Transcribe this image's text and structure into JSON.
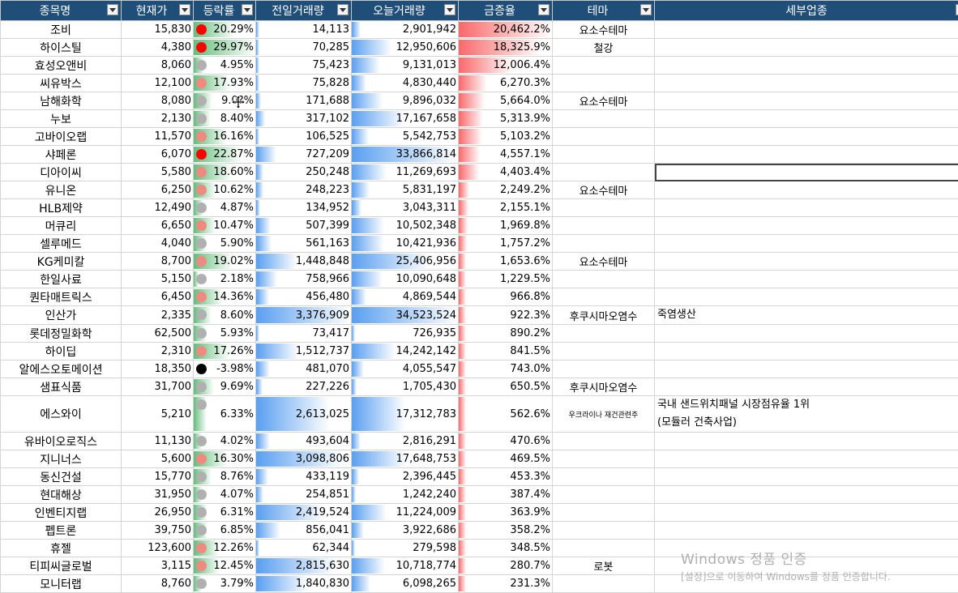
{
  "headers": [
    {
      "label": "종목명"
    },
    {
      "label": "현재가"
    },
    {
      "label": "등락률"
    },
    {
      "label": "전일거래량"
    },
    {
      "label": "오늘거래량"
    },
    {
      "label": "금증율"
    },
    {
      "label": "테마"
    },
    {
      "label": "세부업종"
    }
  ],
  "colors": {
    "header_bg": "#1f4e79",
    "bar_green": "#63be7b",
    "bar_blue": "#5a9ff0",
    "bar_red": "#f8696b",
    "dot_red": "#ff0000",
    "dot_pink": "#f08a80",
    "dot_gray": "#b0b0b0",
    "dot_black": "#000000"
  },
  "rows": [
    {
      "name": "조비",
      "price": "15,830",
      "change": "20.29%",
      "dot": "red",
      "chg_pct": 20.29,
      "prev_vol": "14,113",
      "prev_vol_n": 14113,
      "today_vol": "2,901,942",
      "today_vol_n": 2901942,
      "ratio": "20,462.2%",
      "ratio_n": 20462.2,
      "theme": "요소수테마",
      "theme_small": false,
      "sector": ""
    },
    {
      "name": "하이스틸",
      "price": "4,380",
      "change": "29.97%",
      "dot": "red",
      "chg_pct": 29.97,
      "prev_vol": "70,285",
      "prev_vol_n": 70285,
      "today_vol": "12,950,606",
      "today_vol_n": 12950606,
      "ratio": "18,325.9%",
      "ratio_n": 18325.9,
      "theme": "철강",
      "theme_small": false,
      "sector": ""
    },
    {
      "name": "효성오앤비",
      "price": "8,060",
      "change": "4.95%",
      "dot": "gray",
      "chg_pct": 4.95,
      "prev_vol": "75,423",
      "prev_vol_n": 75423,
      "today_vol": "9,131,013",
      "today_vol_n": 9131013,
      "ratio": "12,006.4%",
      "ratio_n": 12006.4,
      "theme": "",
      "theme_small": false,
      "sector": ""
    },
    {
      "name": "씨유박스",
      "price": "12,100",
      "change": "17.93%",
      "dot": "pink",
      "chg_pct": 17.93,
      "prev_vol": "75,828",
      "prev_vol_n": 75828,
      "today_vol": "4,830,440",
      "today_vol_n": 4830440,
      "ratio": "6,270.3%",
      "ratio_n": 6270.3,
      "theme": "",
      "theme_small": false,
      "sector": ""
    },
    {
      "name": "남해화학",
      "price": "8,080",
      "change": "9.0?%",
      "dot": "gray",
      "chg_pct": 9.0,
      "prev_vol": "171,688",
      "prev_vol_n": 171688,
      "today_vol": "9,896,032",
      "today_vol_n": 9896032,
      "ratio": "5,664.0%",
      "ratio_n": 5664.0,
      "theme": "요소수테마",
      "theme_small": false,
      "sector": ""
    },
    {
      "name": "누보",
      "price": "2,130",
      "change": "8.40%",
      "dot": "gray",
      "chg_pct": 8.4,
      "prev_vol": "317,102",
      "prev_vol_n": 317102,
      "today_vol": "17,167,658",
      "today_vol_n": 17167658,
      "ratio": "5,313.9%",
      "ratio_n": 5313.9,
      "theme": "",
      "theme_small": false,
      "sector": ""
    },
    {
      "name": "고바이오랩",
      "price": "11,570",
      "change": "16.16%",
      "dot": "pink",
      "chg_pct": 16.16,
      "prev_vol": "106,525",
      "prev_vol_n": 106525,
      "today_vol": "5,542,753",
      "today_vol_n": 5542753,
      "ratio": "5,103.2%",
      "ratio_n": 5103.2,
      "theme": "",
      "theme_small": false,
      "sector": ""
    },
    {
      "name": "샤페론",
      "price": "6,070",
      "change": "22.87%",
      "dot": "red",
      "chg_pct": 22.87,
      "prev_vol": "727,209",
      "prev_vol_n": 727209,
      "today_vol": "33,866,814",
      "today_vol_n": 33866814,
      "ratio": "4,557.1%",
      "ratio_n": 4557.1,
      "theme": "",
      "theme_small": false,
      "sector": ""
    },
    {
      "name": "디아이씨",
      "price": "5,580",
      "change": "18.60%",
      "dot": "pink",
      "chg_pct": 18.6,
      "prev_vol": "250,248",
      "prev_vol_n": 250248,
      "today_vol": "11,269,693",
      "today_vol_n": 11269693,
      "ratio": "4,403.4%",
      "ratio_n": 4403.4,
      "theme": "",
      "theme_small": false,
      "sector": ""
    },
    {
      "name": "유니온",
      "price": "6,250",
      "change": "10.62%",
      "dot": "pink",
      "chg_pct": 10.62,
      "prev_vol": "248,223",
      "prev_vol_n": 248223,
      "today_vol": "5,831,197",
      "today_vol_n": 5831197,
      "ratio": "2,249.2%",
      "ratio_n": 2249.2,
      "theme": "요소수테마",
      "theme_small": false,
      "sector": ""
    },
    {
      "name": "HLB제약",
      "price": "12,490",
      "change": "4.87%",
      "dot": "gray",
      "chg_pct": 4.87,
      "prev_vol": "134,952",
      "prev_vol_n": 134952,
      "today_vol": "3,043,311",
      "today_vol_n": 3043311,
      "ratio": "2,155.1%",
      "ratio_n": 2155.1,
      "theme": "",
      "theme_small": false,
      "sector": ""
    },
    {
      "name": "머큐리",
      "price": "6,650",
      "change": "10.47%",
      "dot": "pink",
      "chg_pct": 10.47,
      "prev_vol": "507,399",
      "prev_vol_n": 507399,
      "today_vol": "10,502,348",
      "today_vol_n": 10502348,
      "ratio": "1,969.8%",
      "ratio_n": 1969.8,
      "theme": "",
      "theme_small": false,
      "sector": ""
    },
    {
      "name": "셀루메드",
      "price": "4,040",
      "change": "5.90%",
      "dot": "gray",
      "chg_pct": 5.9,
      "prev_vol": "561,163",
      "prev_vol_n": 561163,
      "today_vol": "10,421,936",
      "today_vol_n": 10421936,
      "ratio": "1,757.2%",
      "ratio_n": 1757.2,
      "theme": "",
      "theme_small": false,
      "sector": ""
    },
    {
      "name": "KG케미칼",
      "price": "8,700",
      "change": "19.02%",
      "dot": "pink",
      "chg_pct": 19.02,
      "prev_vol": "1,448,848",
      "prev_vol_n": 1448848,
      "today_vol": "25,406,956",
      "today_vol_n": 25406956,
      "ratio": "1,653.6%",
      "ratio_n": 1653.6,
      "theme": "요소수테마",
      "theme_small": false,
      "sector": ""
    },
    {
      "name": "한일사료",
      "price": "5,150",
      "change": "2.18%",
      "dot": "gray",
      "chg_pct": 2.18,
      "prev_vol": "758,966",
      "prev_vol_n": 758966,
      "today_vol": "10,090,648",
      "today_vol_n": 10090648,
      "ratio": "1,229.5%",
      "ratio_n": 1229.5,
      "theme": "",
      "theme_small": false,
      "sector": ""
    },
    {
      "name": "퀀타매트릭스",
      "price": "6,450",
      "change": "14.36%",
      "dot": "pink",
      "chg_pct": 14.36,
      "prev_vol": "456,480",
      "prev_vol_n": 456480,
      "today_vol": "4,869,544",
      "today_vol_n": 4869544,
      "ratio": "966.8%",
      "ratio_n": 966.8,
      "theme": "",
      "theme_small": false,
      "sector": ""
    },
    {
      "name": "인산가",
      "price": "2,335",
      "change": "8.60%",
      "dot": "gray",
      "chg_pct": 8.6,
      "prev_vol": "3,376,909",
      "prev_vol_n": 3376909,
      "today_vol": "34,523,524",
      "today_vol_n": 34523524,
      "ratio": "922.3%",
      "ratio_n": 922.3,
      "theme": "후쿠시마오염수",
      "theme_small": false,
      "sector": "죽염생산"
    },
    {
      "name": "롯데정밀화학",
      "price": "62,500",
      "change": "5.93%",
      "dot": "gray",
      "chg_pct": 5.93,
      "prev_vol": "73,417",
      "prev_vol_n": 73417,
      "today_vol": "726,935",
      "today_vol_n": 726935,
      "ratio": "890.2%",
      "ratio_n": 890.2,
      "theme": "",
      "theme_small": false,
      "sector": ""
    },
    {
      "name": "하이딥",
      "price": "2,310",
      "change": "17.26%",
      "dot": "pink",
      "chg_pct": 17.26,
      "prev_vol": "1,512,737",
      "prev_vol_n": 1512737,
      "today_vol": "14,242,142",
      "today_vol_n": 14242142,
      "ratio": "841.5%",
      "ratio_n": 841.5,
      "theme": "",
      "theme_small": false,
      "sector": ""
    },
    {
      "name": "알에스오토메이션",
      "price": "18,350",
      "change": "-3.98%",
      "dot": "black",
      "chg_pct": -3.98,
      "prev_vol": "481,070",
      "prev_vol_n": 481070,
      "today_vol": "4,055,547",
      "today_vol_n": 4055547,
      "ratio": "743.0%",
      "ratio_n": 743.0,
      "theme": "",
      "theme_small": false,
      "sector": ""
    },
    {
      "name": "샘표식품",
      "price": "31,700",
      "change": "9.69%",
      "dot": "gray",
      "chg_pct": 9.69,
      "prev_vol": "227,226",
      "prev_vol_n": 227226,
      "today_vol": "1,705,430",
      "today_vol_n": 1705430,
      "ratio": "650.5%",
      "ratio_n": 650.5,
      "theme": "후쿠시마오염수",
      "theme_small": false,
      "sector": ""
    },
    {
      "name": "에스와이",
      "price": "5,210",
      "change": "6.33%",
      "dot": "gray",
      "chg_pct": 6.33,
      "prev_vol": "2,613,025",
      "prev_vol_n": 2613025,
      "today_vol": "17,312,783",
      "today_vol_n": 17312783,
      "ratio": "562.6%",
      "ratio_n": 562.6,
      "theme": "우크라이나 재건관련주",
      "theme_small": true,
      "sector": "국내 샌드위치패널 시장점유율 1위\n(모듈러 건축사업)",
      "tall": true
    },
    {
      "name": "유바이오로직스",
      "price": "11,130",
      "change": "4.02%",
      "dot": "gray",
      "chg_pct": 4.02,
      "prev_vol": "493,604",
      "prev_vol_n": 493604,
      "today_vol": "2,816,291",
      "today_vol_n": 2816291,
      "ratio": "470.6%",
      "ratio_n": 470.6,
      "theme": "",
      "theme_small": false,
      "sector": ""
    },
    {
      "name": "지니너스",
      "price": "5,600",
      "change": "16.30%",
      "dot": "pink",
      "chg_pct": 16.3,
      "prev_vol": "3,098,806",
      "prev_vol_n": 3098806,
      "today_vol": "17,648,753",
      "today_vol_n": 17648753,
      "ratio": "469.5%",
      "ratio_n": 469.5,
      "theme": "",
      "theme_small": false,
      "sector": ""
    },
    {
      "name": "동신건설",
      "price": "15,770",
      "change": "8.76%",
      "dot": "gray",
      "chg_pct": 8.76,
      "prev_vol": "433,119",
      "prev_vol_n": 433119,
      "today_vol": "2,396,445",
      "today_vol_n": 2396445,
      "ratio": "453.3%",
      "ratio_n": 453.3,
      "theme": "",
      "theme_small": false,
      "sector": ""
    },
    {
      "name": "현대해상",
      "price": "31,950",
      "change": "4.07%",
      "dot": "gray",
      "chg_pct": 4.07,
      "prev_vol": "254,851",
      "prev_vol_n": 254851,
      "today_vol": "1,242,240",
      "today_vol_n": 1242240,
      "ratio": "387.4%",
      "ratio_n": 387.4,
      "theme": "",
      "theme_small": false,
      "sector": ""
    },
    {
      "name": "인벤티지랩",
      "price": "26,950",
      "change": "6.31%",
      "dot": "gray",
      "chg_pct": 6.31,
      "prev_vol": "2,419,524",
      "prev_vol_n": 2419524,
      "today_vol": "11,224,009",
      "today_vol_n": 11224009,
      "ratio": "363.9%",
      "ratio_n": 363.9,
      "theme": "",
      "theme_small": false,
      "sector": ""
    },
    {
      "name": "펩트론",
      "price": "39,750",
      "change": "6.85%",
      "dot": "gray",
      "chg_pct": 6.85,
      "prev_vol": "856,041",
      "prev_vol_n": 856041,
      "today_vol": "3,922,686",
      "today_vol_n": 3922686,
      "ratio": "358.2%",
      "ratio_n": 358.2,
      "theme": "",
      "theme_small": false,
      "sector": ""
    },
    {
      "name": "휴젤",
      "price": "123,600",
      "change": "12.26%",
      "dot": "pink",
      "chg_pct": 12.26,
      "prev_vol": "62,344",
      "prev_vol_n": 62344,
      "today_vol": "279,598",
      "today_vol_n": 279598,
      "ratio": "348.5%",
      "ratio_n": 348.5,
      "theme": "",
      "theme_small": false,
      "sector": ""
    },
    {
      "name": "티피씨글로벌",
      "price": "3,115",
      "change": "12.45%",
      "dot": "pink",
      "chg_pct": 12.45,
      "prev_vol": "2,815,630",
      "prev_vol_n": 2815630,
      "today_vol": "10,718,774",
      "today_vol_n": 10718774,
      "ratio": "280.7%",
      "ratio_n": 280.7,
      "theme": "로봇",
      "theme_small": false,
      "sector": ""
    },
    {
      "name": "모니터랩",
      "price": "8,760",
      "change": "3.79%",
      "dot": "gray",
      "chg_pct": 3.79,
      "prev_vol": "1,840,830",
      "prev_vol_n": 1840830,
      "today_vol": "6,098,265",
      "today_vol_n": 6098265,
      "ratio": "231.3%",
      "ratio_n": 231.3,
      "theme": "",
      "theme_small": false,
      "sector": ""
    }
  ],
  "watermark": {
    "line1": "Windows 정품 인증",
    "line2": "[설정]으로 이동하여 Windows를 정품 인증합니다."
  }
}
